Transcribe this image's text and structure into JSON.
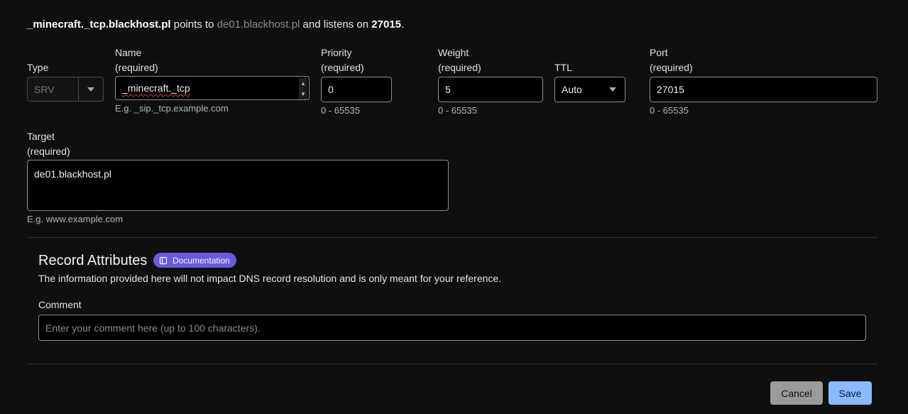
{
  "summary": {
    "name": "_minecraft._tcp.blackhost.pl",
    "points_to_text": "points to",
    "target": "de01.blackhost.pl",
    "listens_text": "and listens on",
    "port": "27015",
    "period": "."
  },
  "type": {
    "label": "Type",
    "value": "SRV"
  },
  "name": {
    "label": "Name",
    "required": "(required)",
    "value": "_minecraft._tcp",
    "hint": "E.g. _sip._tcp.example.com"
  },
  "priority": {
    "label": "Priority",
    "required": "(required)",
    "value": "0",
    "hint": "0 - 65535"
  },
  "weight": {
    "label": "Weight",
    "required": "(required)",
    "value": "5",
    "hint": "0 - 65535"
  },
  "ttl": {
    "label": "TTL",
    "value": "Auto"
  },
  "port": {
    "label": "Port",
    "required": "(required)",
    "value": "27015",
    "hint": "0 - 65535"
  },
  "target": {
    "label": "Target",
    "required": "(required)",
    "value": "de01.blackhost.pl",
    "hint": "E.g. www.example.com"
  },
  "attributes": {
    "title": "Record Attributes",
    "doc_label": "Documentation",
    "description": "The information provided here will not impact DNS record resolution and is only meant for your reference.",
    "comment_label": "Comment",
    "comment_placeholder": "Enter your comment here (up to 100 characters)."
  },
  "buttons": {
    "cancel": "Cancel",
    "save": "Save"
  },
  "colors": {
    "badge": "#6b5bdc",
    "save": "#8ab9ff",
    "cancel": "#9a9a9a"
  }
}
